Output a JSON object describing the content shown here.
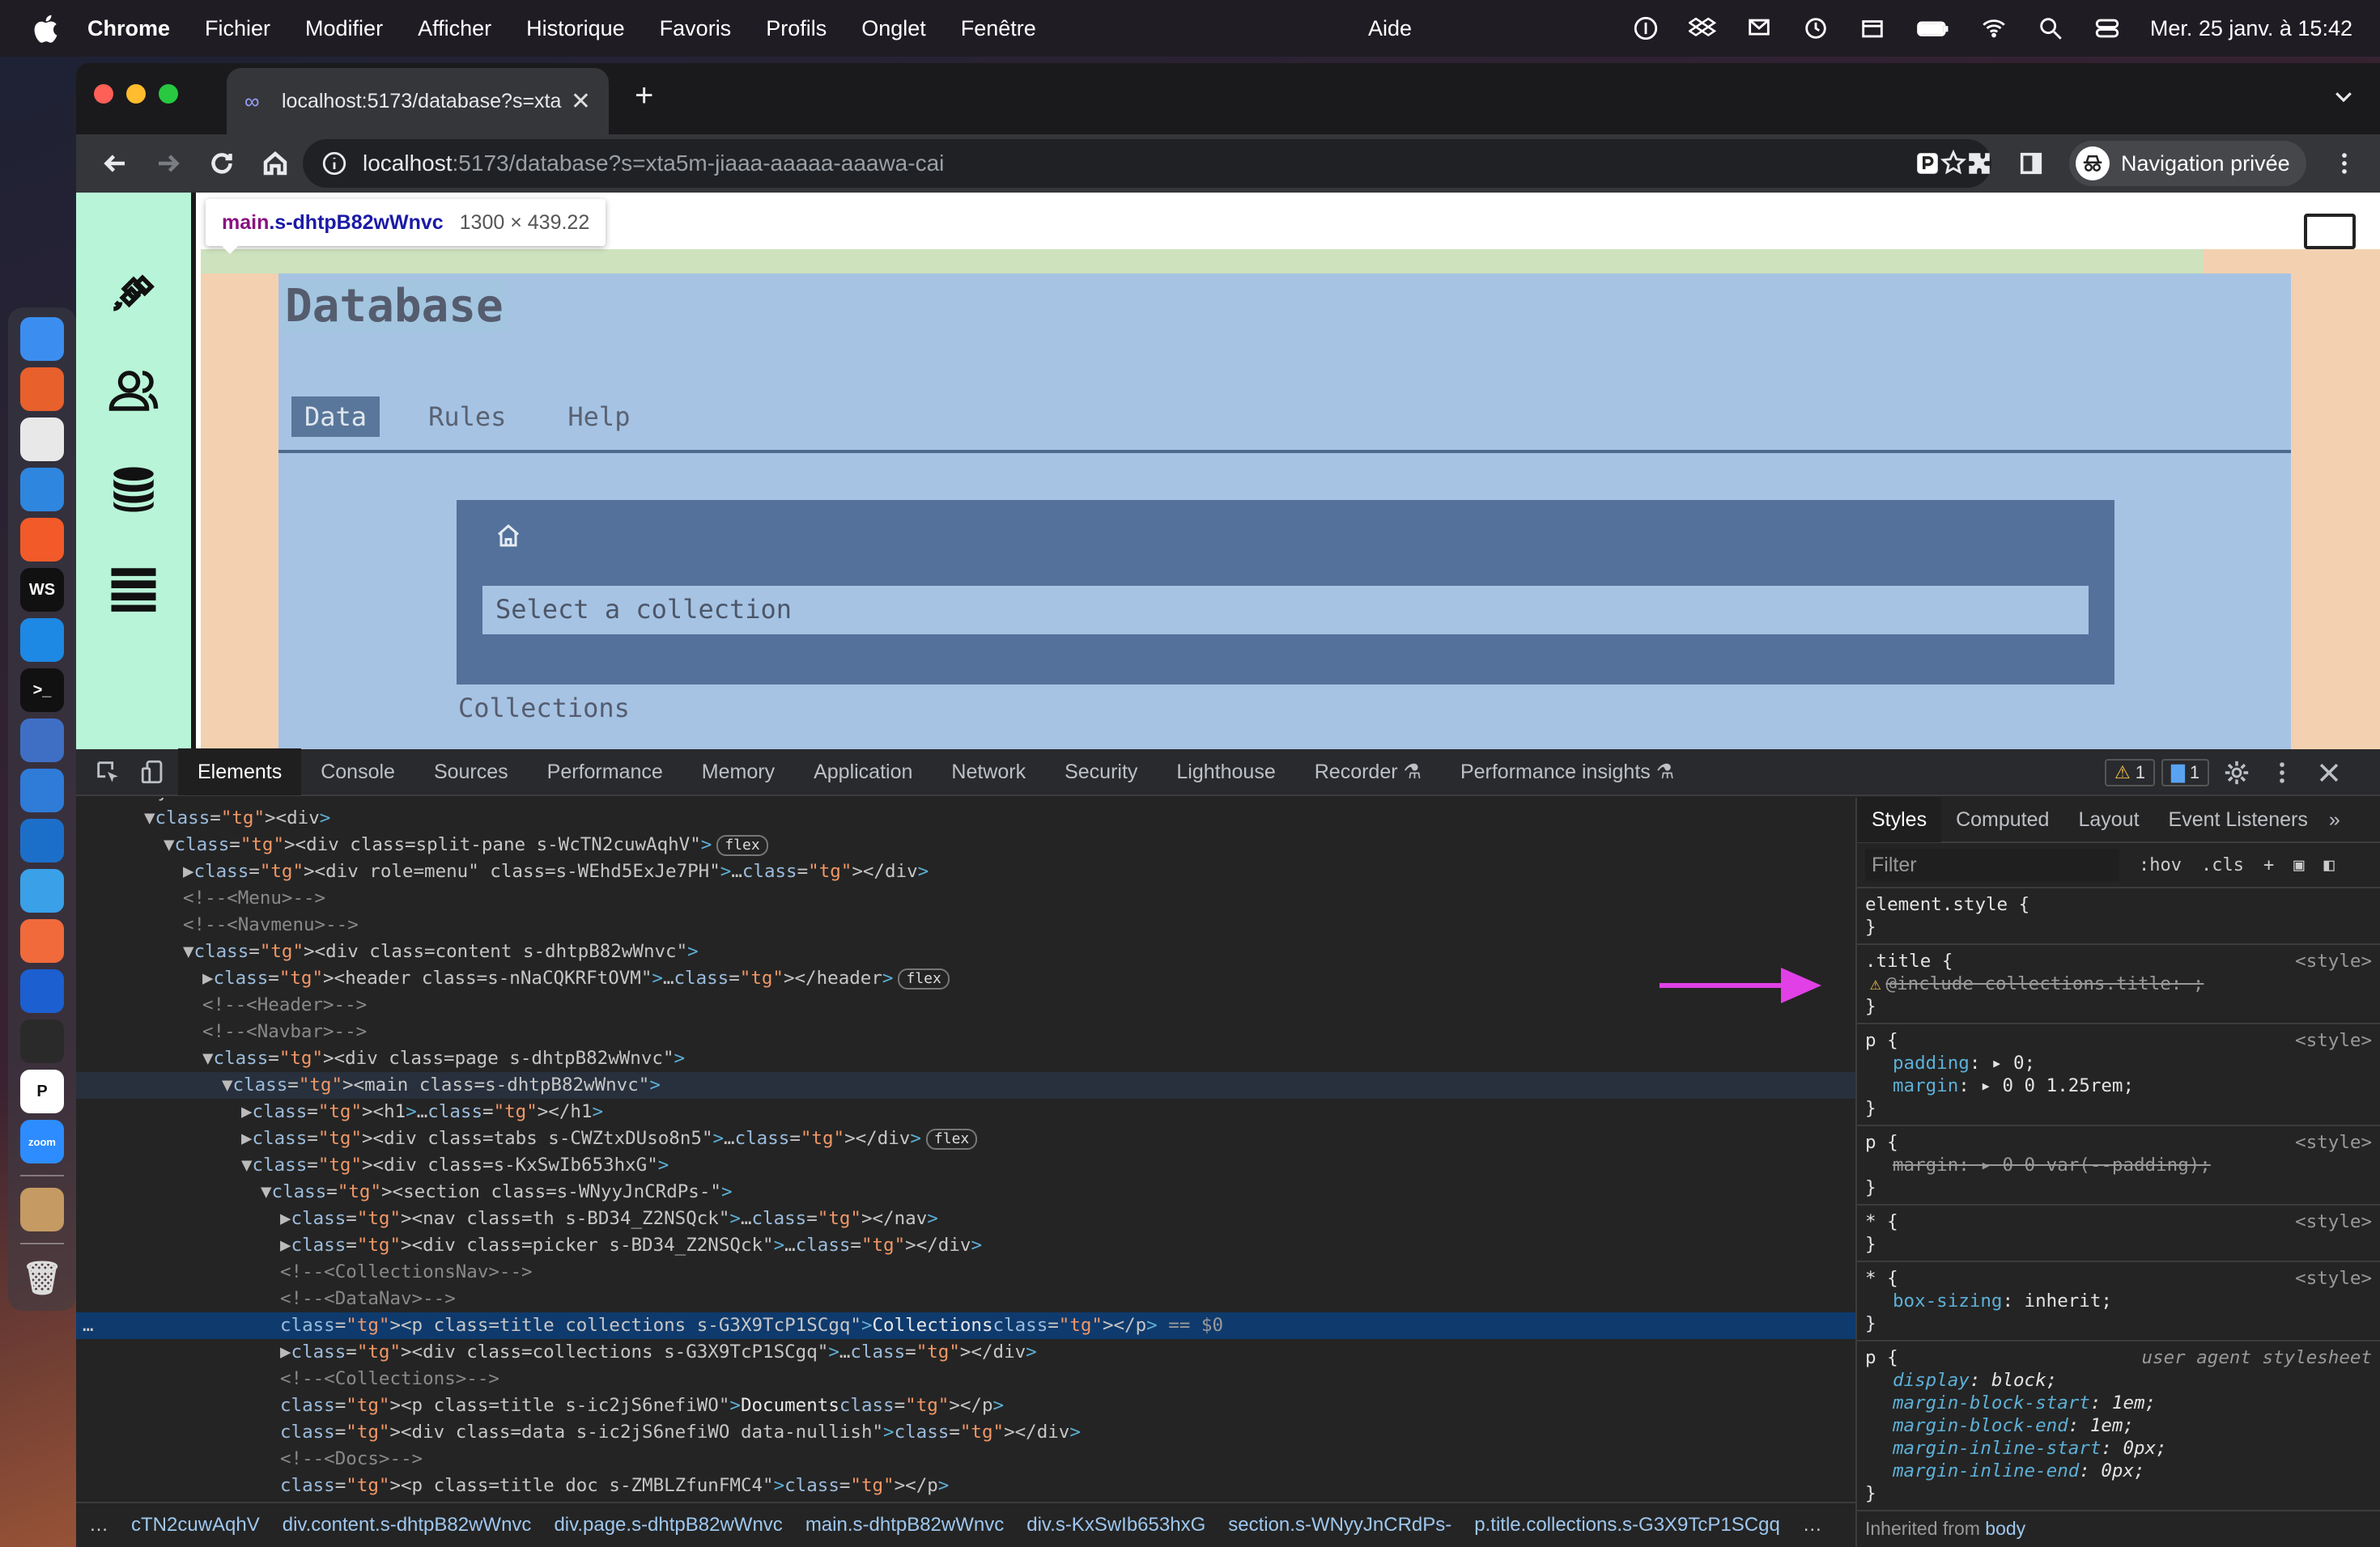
{
  "menubar": {
    "app": "Chrome",
    "items": [
      "Fichier",
      "Modifier",
      "Afficher",
      "Historique",
      "Favoris",
      "Profils",
      "Onglet",
      "Fenêtre"
    ],
    "help": "Aide",
    "clock": "Mer. 25 janv. à 15:42"
  },
  "dock": {
    "apps": [
      {
        "name": "finder",
        "color": "#3b8ef0",
        "glyph": ""
      },
      {
        "name": "firefox",
        "color": "#e8602c",
        "glyph": ""
      },
      {
        "name": "chrome",
        "color": "#e8e8e8",
        "glyph": ""
      },
      {
        "name": "safari",
        "color": "#2e86de",
        "glyph": ""
      },
      {
        "name": "brave",
        "color": "#f25a29",
        "glyph": ""
      },
      {
        "name": "webstorm",
        "color": "#111",
        "glyph": "WS"
      },
      {
        "name": "vscode",
        "color": "#1e88e5",
        "glyph": ""
      },
      {
        "name": "terminal",
        "color": "#111",
        "glyph": ">_"
      },
      {
        "name": "xcode",
        "color": "#3f6fc4",
        "glyph": ""
      },
      {
        "name": "app-blue",
        "color": "#2f7bd8",
        "glyph": ""
      },
      {
        "name": "app-cloud",
        "color": "#1c6fc9",
        "glyph": ""
      },
      {
        "name": "affinity",
        "color": "#3aa0e8",
        "glyph": ""
      },
      {
        "name": "figma-like",
        "color": "#f06a3c",
        "glyph": ""
      },
      {
        "name": "1password",
        "color": "#1b5fd1",
        "glyph": ""
      },
      {
        "name": "activity",
        "color": "#2a2a2a",
        "glyph": ""
      },
      {
        "name": "p-app",
        "color": "#fff",
        "glyph": "P"
      },
      {
        "name": "zoom",
        "color": "#2d8cff",
        "glyph": "zoom"
      },
      {
        "name": "archive",
        "color": "#c59a63",
        "glyph": ""
      }
    ]
  },
  "browser": {
    "tab_title": "localhost:5173/database?s=xta",
    "url_host": "localhost",
    "url_path": ":5173/database?s=xta5m-jiaaa-aaaaa-aaawa-cai",
    "incognito": "Navigation privée"
  },
  "page": {
    "tooltip": {
      "tag": "main",
      "cls": ".s-dhtpB82wWnvc",
      "dims": "1300 × 439.22"
    },
    "title": "Database",
    "tabs": [
      "Data",
      "Rules",
      "Help"
    ],
    "active_tab": "Data",
    "picker_placeholder": "Select a collection",
    "collections_label": "Collections"
  },
  "devtools": {
    "tabs": [
      "Elements",
      "Console",
      "Sources",
      "Performance",
      "Memory",
      "Application",
      "Network",
      "Security",
      "Lighthouse",
      "Recorder",
      "Performance insights"
    ],
    "warnings": "1",
    "messages": "1",
    "styles_tabs": [
      "Styles",
      "Computed",
      "Layout",
      "Event Listeners"
    ],
    "filter_placeholder": "Filter",
    "hov": ":hov",
    "cls": ".cls",
    "breadcrumb": [
      "cTN2cuwAqhV",
      "div.content.s-dhtpB82wWnvc",
      "div.page.s-dhtpB82wWnvc",
      "main.s-dhtpB82wWnvc",
      "div.s-KxSwIb653hxG",
      "section.s-WNyyJnCRdPs-",
      "p.title.collections.s-G3X9TcP1SCgq"
    ],
    "inherited": "Inherited from",
    "inherited_from": "body",
    "dom": [
      {
        "t": "c",
        "txt": "body>"
      },
      {
        "t": "o",
        "txt": "<div>"
      },
      {
        "t": "o",
        "txt": "<div class=\"split-pane s-WcTN2cuwAqhV\">",
        "pill": "flex"
      },
      {
        "t": "x",
        "txt": "<div role=\"menu\" class=\"s-WEhd5ExJe7PH\">…</div>"
      },
      {
        "t": "c",
        "txt": "<!--<Menu>-->"
      },
      {
        "t": "c",
        "txt": "<!--<Navmenu>-->"
      },
      {
        "t": "o",
        "txt": "<div class=\"content s-dhtpB82wWnvc\">"
      },
      {
        "t": "x",
        "txt": "<header class=\"s-nNaCQKRFtOVM\">…</header>",
        "pill": "flex"
      },
      {
        "t": "c",
        "txt": "<!--<Header>-->"
      },
      {
        "t": "c",
        "txt": "<!--<Navbar>-->"
      },
      {
        "t": "o",
        "txt": "<div class=\"page s-dhtpB82wWnvc\">"
      },
      {
        "t": "o",
        "txt": "<main class=\"s-dhtpB82wWnvc\">"
      },
      {
        "t": "x",
        "txt": "<h1>…</h1>"
      },
      {
        "t": "x",
        "txt": "<div class=\"tabs s-CWZtxDUso8n5\">…</div>",
        "pill": "flex"
      },
      {
        "t": "o",
        "txt": "<div class=\"s-KxSwIb653hxG\">"
      },
      {
        "t": "o",
        "txt": "<section class=\"s-WNyyJnCRdPs-\">"
      },
      {
        "t": "x",
        "txt": "<nav class=\"th s-BD34_Z2NSQck\">…</nav>"
      },
      {
        "t": "x",
        "txt": "<div class=\"picker s-BD34_Z2NSQck\">…</div>"
      },
      {
        "t": "c",
        "txt": "<!--<CollectionsNav>-->"
      },
      {
        "t": "c",
        "txt": "<!--<DataNav>-->"
      },
      {
        "t": "s",
        "txt": "<p class=\"title collections s-G3X9TcP1SCgq\">Collections</p> == $0"
      },
      {
        "t": "x",
        "txt": "<div class=\"collections s-G3X9TcP1SCgq\">…</div>"
      },
      {
        "t": "c",
        "txt": "<!--<Collections>-->"
      },
      {
        "t": "l",
        "txt": "<p class=\"title s-ic2jS6nefiWO\">Documents</p>"
      },
      {
        "t": "l",
        "txt": "<div class=\"data s-ic2jS6nefiWO data-nullish\"></div>"
      },
      {
        "t": "c",
        "txt": "<!--<Docs>-->"
      },
      {
        "t": "l",
        "txt": "<p class=\"title doc s-ZMBLZfunFMC4\"></p>"
      }
    ],
    "rules": [
      {
        "sel": "element.style {",
        "src": "",
        "props": []
      },
      {
        "sel": ".title {",
        "src": "<style>",
        "props": [
          {
            "warn": true,
            "strike": true,
            "text": "@include collections.title: ;"
          }
        ]
      },
      {
        "sel": "p {",
        "src": "<style>",
        "props": [
          {
            "n": "padding",
            "v": "▸ 0;"
          },
          {
            "n": "margin",
            "v": "▸ 0 0 1.25rem;"
          }
        ]
      },
      {
        "sel": "p {",
        "src": "<style>",
        "props": [
          {
            "strike": true,
            "text": "margin: ▸ 0 0 var(--padding);"
          }
        ]
      },
      {
        "sel": "* {",
        "src": "<style>",
        "props": []
      },
      {
        "sel": "* {",
        "src": "<style>",
        "props": [
          {
            "n": "box-sizing",
            "v": "inherit;"
          }
        ]
      },
      {
        "sel": "p {",
        "src": "user agent stylesheet",
        "ital": true,
        "props": [
          {
            "n": "display",
            "v": "block;"
          },
          {
            "n": "margin-block-start",
            "v": "1em;"
          },
          {
            "n": "margin-block-end",
            "v": "1em;"
          },
          {
            "n": "margin-inline-start",
            "v": "0px;"
          },
          {
            "n": "margin-inline-end",
            "v": "0px;"
          }
        ]
      }
    ]
  }
}
